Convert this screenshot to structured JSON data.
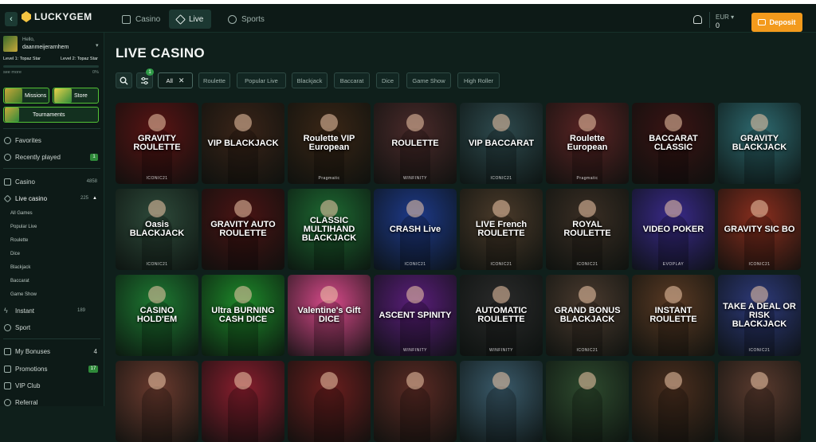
{
  "topbar": {
    "brand": "LUCKYGEM",
    "tabs": [
      {
        "label": "Casino",
        "icon": "casino-icon",
        "active": false
      },
      {
        "label": "Live",
        "icon": "live-icon",
        "active": true
      },
      {
        "label": "Sports",
        "icon": "sports-icon",
        "active": false
      }
    ],
    "currency": "EUR",
    "balance": "0",
    "deposit_label": "Deposit",
    "accent": "#f39a1c"
  },
  "profile": {
    "greeting": "Hello,",
    "username": "daanmeijerarnhem",
    "level_current": "Level 1: Topaz Star",
    "level_next": "Level 2: Topaz Star",
    "progress_percent": 0,
    "see_more": "see more",
    "percent_label": "0%"
  },
  "promos": {
    "missions": "Missions",
    "store": "Store",
    "tournaments": "Tournaments"
  },
  "sidebar": {
    "favorites": "Favorites",
    "recently_played": "Recently played",
    "recently_played_badge": "1",
    "casino": "Casino",
    "casino_count": "4858",
    "live_casino": "Live casino",
    "live_casino_count": "225",
    "live_sub": [
      "All Games",
      "Popular Live",
      "Roulette",
      "Dice",
      "Blackjack",
      "Baccarat",
      "Game Show"
    ],
    "instant": "Instant",
    "instant_count": "189",
    "sport": "Sport",
    "my_bonuses": "My Bonuses",
    "my_bonuses_count": "4",
    "promotions": "Promotions",
    "promotions_badge": "17",
    "vip_club": "VIP Club",
    "referral": "Referral"
  },
  "main": {
    "title": "LIVE CASINO",
    "filter_badge": "1",
    "chips": [
      "All",
      "Roulette",
      "Popular Live",
      "Blackjack",
      "Baccarat",
      "Dice",
      "Game Show",
      "High Roller"
    ]
  },
  "games": [
    {
      "name": "GRAVITY ROULETTE",
      "studio": "ICONIC21"
    },
    {
      "name": "VIP BLACKJACK",
      "studio": ""
    },
    {
      "name": "Roulette VIP European",
      "studio": "Pragmatic"
    },
    {
      "name": "ROULETTE",
      "studio": "WINFINITY"
    },
    {
      "name": "VIP BACCARAT",
      "studio": "ICONIC21"
    },
    {
      "name": "Roulette European",
      "studio": "Pragmatic"
    },
    {
      "name": "BACCARAT CLASSIC",
      "studio": ""
    },
    {
      "name": "GRAVITY BLACKJACK",
      "studio": ""
    },
    {
      "name": "Oasis BLACKJACK",
      "studio": "ICONIC21"
    },
    {
      "name": "GRAVITY AUTO ROULETTE",
      "studio": ""
    },
    {
      "name": "CLASSIC MULTIHAND BLACKJACK",
      "studio": ""
    },
    {
      "name": "CRASH Live",
      "studio": "ICONIC21"
    },
    {
      "name": "LIVE French ROULETTE",
      "studio": "ICONIC21"
    },
    {
      "name": "ROYAL ROULETTE",
      "studio": "ICONIC21"
    },
    {
      "name": "VIDEO POKER",
      "studio": "EVOPLAY"
    },
    {
      "name": "GRAVITY SIC BO",
      "studio": "ICONIC21"
    },
    {
      "name": "CASINO HOLD'EM",
      "studio": ""
    },
    {
      "name": "Ultra BURNING CASH DICE",
      "studio": ""
    },
    {
      "name": "Valentine's Gift DICE",
      "studio": ""
    },
    {
      "name": "ASCENT SPINITY",
      "studio": "WINFINITY"
    },
    {
      "name": "AUTOMATIC ROULETTE",
      "studio": "WINFINITY"
    },
    {
      "name": "GRAND BONUS BLACKJACK",
      "studio": "ICONIC21"
    },
    {
      "name": "INSTANT ROULETTE",
      "studio": ""
    },
    {
      "name": "TAKE A DEAL OR RISK BLACKJACK",
      "studio": "ICONIC21"
    },
    {
      "name": "",
      "studio": ""
    },
    {
      "name": "",
      "studio": ""
    },
    {
      "name": "",
      "studio": ""
    },
    {
      "name": "",
      "studio": ""
    },
    {
      "name": "",
      "studio": ""
    },
    {
      "name": "",
      "studio": ""
    },
    {
      "name": "",
      "studio": ""
    },
    {
      "name": "",
      "studio": ""
    }
  ],
  "colors": {
    "bg": "#0f1f1b",
    "sidebar": "#0d1a17",
    "promo_green": "#53c236",
    "badge_green": "#2f8a3a",
    "tiles": [
      "#5a1414",
      "#3a2418",
      "#3a2616",
      "#4a2a2a",
      "#2e4a4e",
      "#5a2424",
      "#3a1414",
      "#2e6a70",
      "#2e4a3a",
      "#4a1414",
      "#1e6a32",
      "#1e3a8a",
      "#4a3a2a",
      "#3a2e24",
      "#3a2a8a",
      "#8a2e1e",
      "#1e7a32",
      "#1e8a2a",
      "#d84a8a",
      "#5a1e7a",
      "#2a2a2a",
      "#4a3a2e",
      "#5a3a24",
      "#2e3a7a",
      "#6a3a2e",
      "#8a1e2e",
      "#6a1e1e",
      "#5a2a24",
      "#3a5a6a",
      "#2e4a2e",
      "#4a2e1e",
      "#5a3a2e"
    ]
  }
}
